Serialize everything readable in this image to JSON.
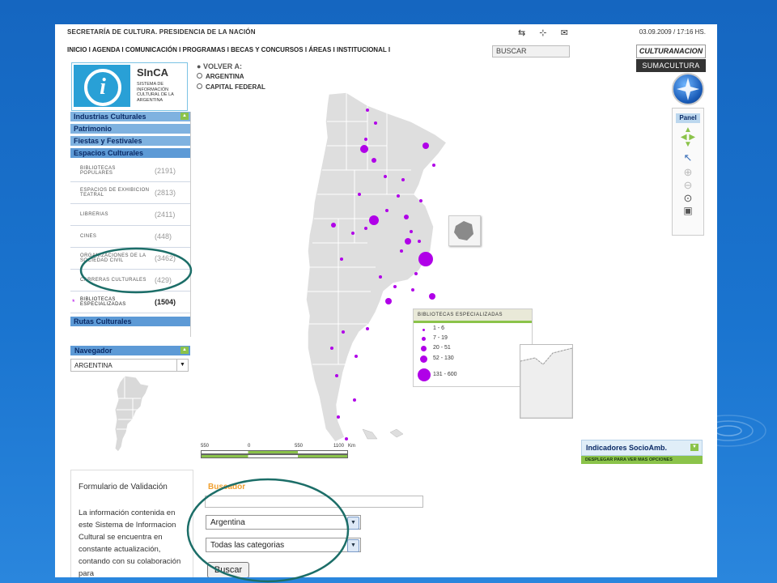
{
  "header": {
    "secretaria": "SECRETARÍA DE CULTURA. PRESIDENCIA DE LA NACIÓN",
    "datetime": "03.09.2009 / 17:16 HS.",
    "search_placeholder": "BUSCAR",
    "cultura_nacion": "CULTURANACION",
    "suma_cultura": "SUMACULTURA",
    "nav": [
      "INICIO",
      "AGENDA",
      "COMUNICACIÓN",
      "PROGRAMAS",
      "BECAS Y CONCURSOS",
      "ÁREAS",
      "INSTITUCIONAL"
    ]
  },
  "logo": {
    "title": "SInCA",
    "subtitle": "SISTEMA DE INFORMACIÓN CULTURAL DE LA ARGENTINA"
  },
  "breadcrumb": {
    "volver": "VOLVER A:",
    "items": [
      "ARGENTINA",
      "CAPITAL FEDERAL"
    ]
  },
  "sidebar": {
    "categories": [
      "Industrias Culturales",
      "Patrimonio",
      "Fiestas y Festivales",
      "Espacios Culturales"
    ],
    "subitems": [
      {
        "name": "BIBLIOTECAS POPULARES",
        "count": "(2191)"
      },
      {
        "name": "ESPACIOS DE EXHIBICION TEATRAL",
        "count": "(2813)"
      },
      {
        "name": "LIBRERIAS",
        "count": "(2411)"
      },
      {
        "name": "CINES",
        "count": "(448)"
      },
      {
        "name": "ORGANIZACIONES DE LA SOCIEDAD CIVIL",
        "count": "(3462)"
      },
      {
        "name": "CARRERAS CULTURALES",
        "count": "(429)"
      },
      {
        "name": "BIBLIOTECAS ESPECIALIZADAS",
        "count": "(1504)"
      }
    ],
    "last_category": "Rutas Culturales"
  },
  "navegador": {
    "title": "Navegador",
    "selected": "ARGENTINA"
  },
  "form": {
    "title": "Formulario de Validación",
    "text": "La información contenida en este Sistema de Informacion Cultural se encuentra en constante actualización, contando con su colaboración para"
  },
  "legend": {
    "title": "BIBLIOTECAS ESPECIALIZADAS",
    "ranges": [
      "1 - 6",
      "7 - 19",
      "20 - 51",
      "52 - 130",
      "131 - 600"
    ]
  },
  "scale": {
    "labels": [
      "550",
      "0",
      "550",
      "1100"
    ],
    "unit": "Km"
  },
  "tools": {
    "panel_label": "Panel"
  },
  "indicadores": {
    "title": "Indicadores SocioAmb.",
    "subtitle": "DESPLEGAR PARA VER MAS OPCIONES"
  },
  "buscador": {
    "title": "Buscador",
    "region_selected": "Argentina",
    "category_selected": "Todas las categorias",
    "button": "Buscar"
  },
  "colors": {
    "accent": "#5d9ad6",
    "marker": "#b000e8",
    "green": "#8bc34a",
    "annotation": "#1c6e68"
  }
}
